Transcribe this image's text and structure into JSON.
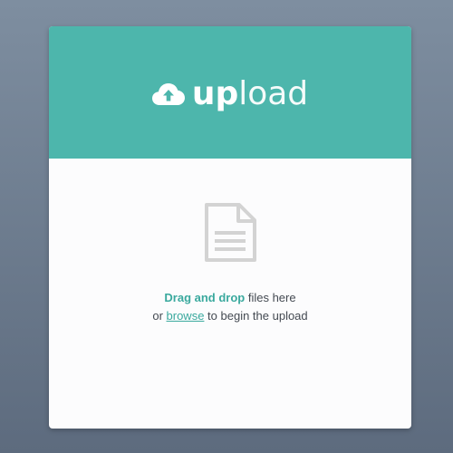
{
  "header": {
    "brand_bold": "up",
    "brand_light": "load",
    "icon": "cloud-upload-icon",
    "bg_color": "#4db6ac"
  },
  "dropzone": {
    "icon": "document-icon",
    "drag_label": "Drag and drop",
    "line1_rest": " files here",
    "line2_prefix": "or ",
    "browse_label": "browse",
    "line2_suffix": " to begin the upload"
  },
  "colors": {
    "accent": "#3aa99e",
    "background_top": "#7e8ea0",
    "background_bottom": "#5d6b7e",
    "card": "#fcfcfd"
  }
}
